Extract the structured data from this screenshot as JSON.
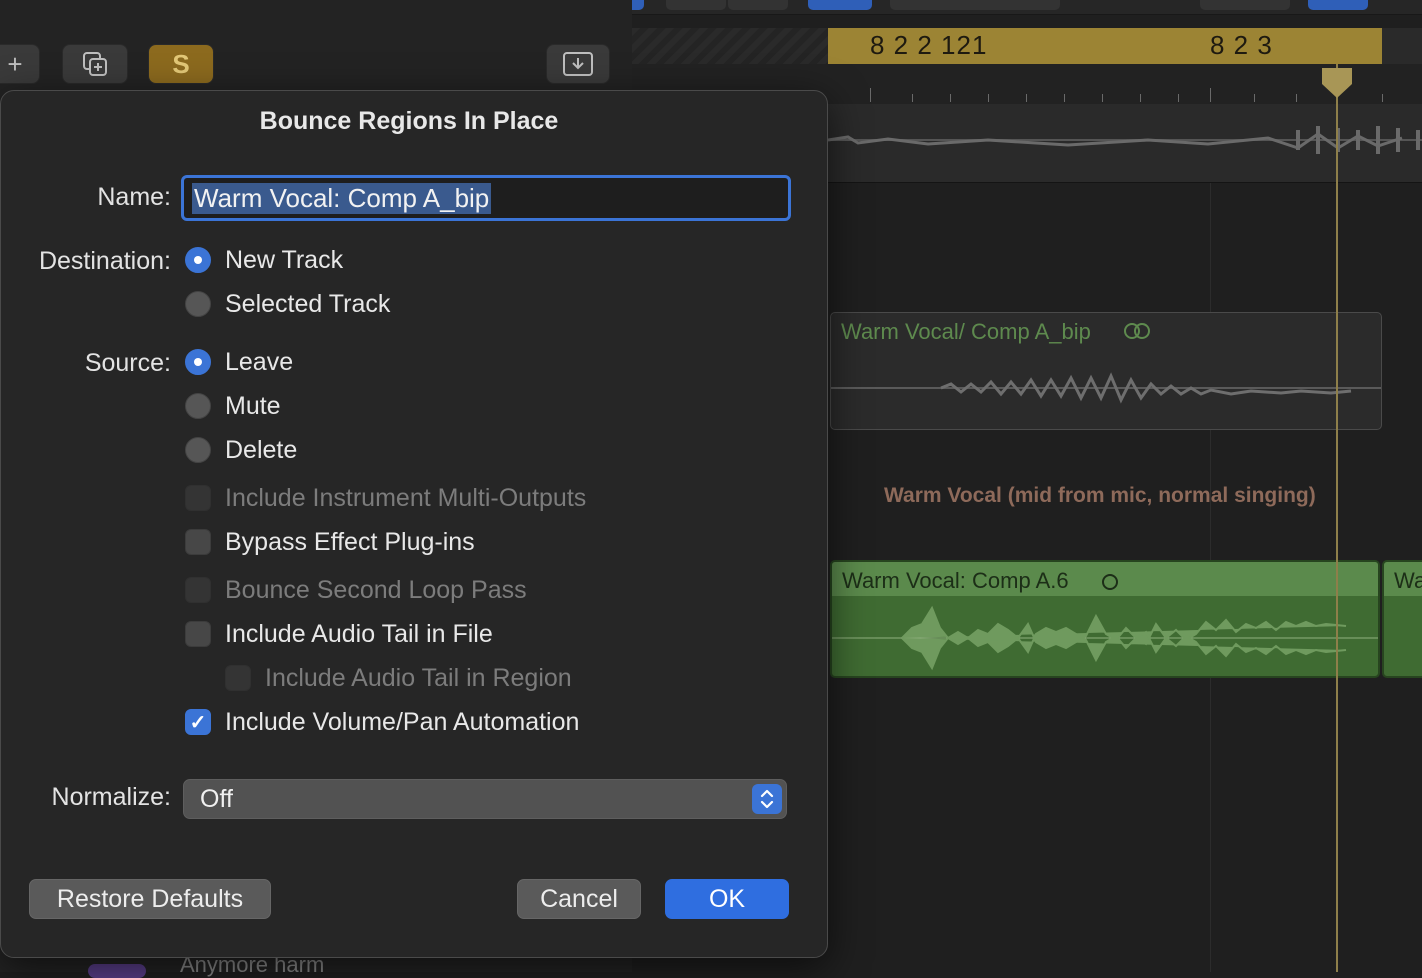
{
  "dialog": {
    "title": "Bounce Regions In Place",
    "name_label": "Name:",
    "name_value": "Warm Vocal: Comp A_bip",
    "destination_label": "Destination:",
    "destination_options": [
      {
        "label": "New Track",
        "selected": true
      },
      {
        "label": "Selected Track",
        "selected": false
      }
    ],
    "source_label": "Source:",
    "source_options": [
      {
        "label": "Leave",
        "selected": true
      },
      {
        "label": "Mute",
        "selected": false
      },
      {
        "label": "Delete",
        "selected": false
      }
    ],
    "checkboxes": [
      {
        "label": "Include Instrument Multi-Outputs",
        "checked": false,
        "enabled": false
      },
      {
        "label": "Bypass Effect Plug-ins",
        "checked": false,
        "enabled": true
      },
      {
        "label": "Bounce Second Loop Pass",
        "checked": false,
        "enabled": false
      },
      {
        "label": "Include Audio Tail in File",
        "checked": false,
        "enabled": true
      },
      {
        "label": "Include Audio Tail in Region",
        "checked": false,
        "enabled": false
      },
      {
        "label": "Include Volume/Pan Automation",
        "checked": true,
        "enabled": true
      }
    ],
    "normalize_label": "Normalize:",
    "normalize_value": "Off",
    "restore_defaults_label": "Restore Defaults",
    "cancel_label": "Cancel",
    "ok_label": "OK"
  },
  "background": {
    "header_buttons": {
      "add": "+",
      "solo": "S"
    },
    "ruler": {
      "marker_1": "8 2 2 121",
      "marker_2": "8 2 3"
    },
    "regions": [
      {
        "label": "Warm Vocal/ Comp A_bip"
      },
      {
        "label": "Warm Vocal: Comp A.6"
      },
      {
        "label": "Wa"
      }
    ],
    "track_title": "Warm Vocal (mid from mic, normal singing)",
    "bottom_track_text": "Anymore harm"
  },
  "colors": {
    "accent": "#3b74d6",
    "cycle": "#9c8434",
    "region_green": "#3f6b32"
  }
}
